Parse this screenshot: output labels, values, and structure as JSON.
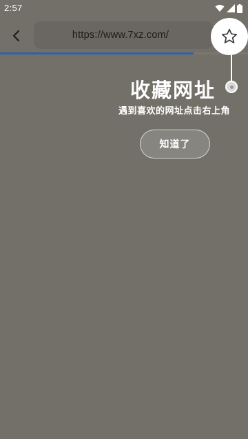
{
  "status_bar": {
    "time": "2:57",
    "icons": [
      "wifi-icon",
      "signal-icon",
      "battery-icon"
    ]
  },
  "toolbar": {
    "url": "https://www.7xz.com/",
    "back_icon": "chevron-left-icon",
    "favorite_icon": "star-icon"
  },
  "progress": {
    "fraction": 0.78,
    "color": "#2f62a3"
  },
  "guide": {
    "title": "收藏网址",
    "subtitle": "遇到喜欢的网址点击右上角",
    "confirm_label": "知道了"
  },
  "colors": {
    "overlay": "#737069",
    "accent": "#2f62a3",
    "text": "#ffffff"
  }
}
